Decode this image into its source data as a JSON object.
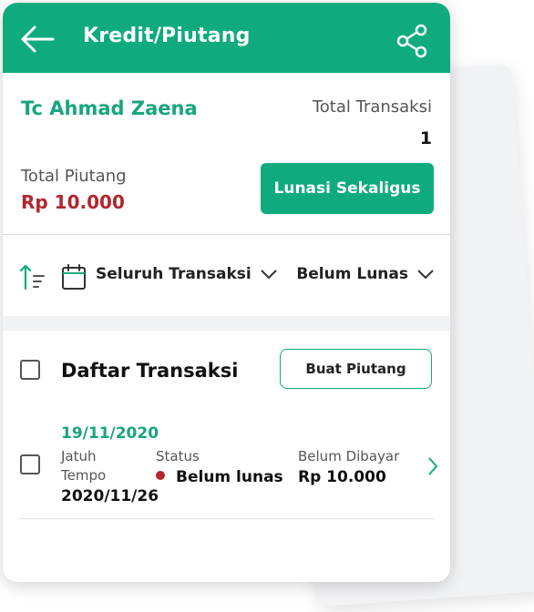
{
  "appbar": {
    "title": "Kredit/Piutang",
    "back_icon": "arrow-left-icon",
    "share_icon": "share-icon",
    "color": "#0fab7f"
  },
  "summary": {
    "customer_name": "Tc Ahmad Zaena",
    "total_transaksi_label": "Total Transaksi",
    "total_transaksi_value": "1",
    "total_piutang_label": "Total Piutang",
    "total_piutang_value": "Rp 10.000",
    "lunasi_button": "Lunasi Sekaligus"
  },
  "filters": {
    "sort_icon": "sort-icon",
    "calendar_icon": "calendar-icon",
    "period": "Seluruh Transaksi",
    "status": "Belum Lunas"
  },
  "list": {
    "title": "Daftar Transaksi",
    "create_button": "Buat Piutang",
    "items": [
      {
        "date": "19/11/2020",
        "due_label_1": "Jatuh",
        "due_label_2": "Tempo",
        "due_value": "2020/11/26",
        "status_label": "Status",
        "status_value": "Belum lunas",
        "unpaid_label": "Belum Dibayar",
        "unpaid_value": "Rp 10.000"
      }
    ]
  },
  "colors": {
    "accent": "#0fab7f",
    "danger": "#b3262e"
  }
}
